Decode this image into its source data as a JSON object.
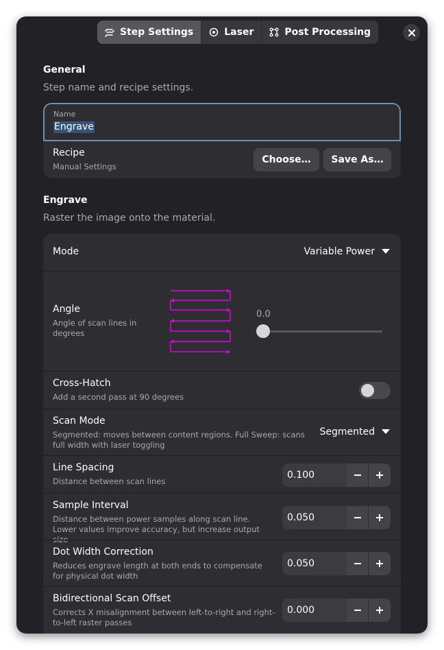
{
  "tabs": [
    {
      "label": "Step Settings",
      "icon": "sliders-icon",
      "active": true
    },
    {
      "label": "Laser",
      "icon": "target-icon",
      "active": false
    },
    {
      "label": "Post Processing",
      "icon": "workflow-icon",
      "active": false
    }
  ],
  "general": {
    "title": "General",
    "description": "Step name and recipe settings.",
    "name_label": "Name",
    "name_value": "Engrave",
    "recipe_title": "Recipe",
    "recipe_sub": "Manual Settings",
    "choose_label": "Choose…",
    "save_as_label": "Save As…"
  },
  "engrave": {
    "title": "Engrave",
    "description": "Raster the image onto the material.",
    "mode": {
      "title": "Mode",
      "value": "Variable Power"
    },
    "angle": {
      "title": "Angle",
      "sub": "Angle of scan lines in degrees",
      "value": "0.0",
      "fraction": 0.0,
      "preview_color": "#e000e0"
    },
    "cross_hatch": {
      "title": "Cross-Hatch",
      "sub": "Add a second pass at 90 degrees",
      "enabled": false
    },
    "scan_mode": {
      "title": "Scan Mode",
      "sub": "Segmented: moves between content regions. Full Sweep: scans full width with laser toggling",
      "value": "Segmented"
    },
    "line_spacing": {
      "title": "Line Spacing",
      "sub": "Distance between scan lines",
      "value": "0.100"
    },
    "sample_interval": {
      "title": "Sample Interval",
      "sub": "Distance between power samples along scan line. Lower values improve accuracy, but increase output size",
      "value": "0.050"
    },
    "dot_width": {
      "title": "Dot Width Correction",
      "sub": "Reduces engrave length at both ends to compensate for physical dot width",
      "value": "0.050"
    },
    "bidi_offset": {
      "title": "Bidirectional Scan Offset",
      "sub": "Corrects X misalignment between left-to-right and right-to-left raster passes",
      "value": "0.000"
    }
  },
  "colors": {
    "dialog_bg": "#222226",
    "card_bg": "#2e2e32",
    "focus_border": "#6e8fae",
    "selection": "#33557d",
    "accent_magenta": "#e000e0"
  }
}
